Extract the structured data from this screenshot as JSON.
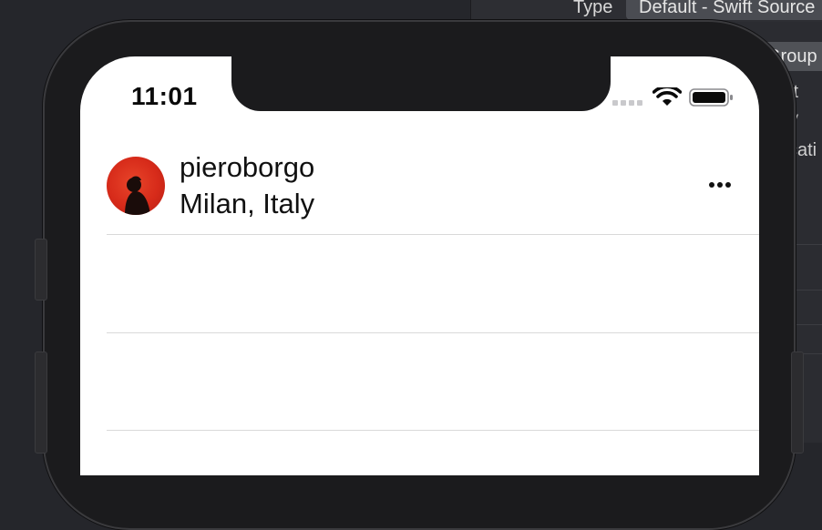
{
  "inspector": {
    "type_label": "Type",
    "type_value": "Default - Swift Source",
    "group_button": "Group",
    "fragments": [
      "ft",
      "y",
      "cati",
      "t"
    ]
  },
  "status_bar": {
    "time": "11:01",
    "icons": [
      "cellular-signal-icon",
      "wifi-icon",
      "battery-icon"
    ]
  },
  "post": {
    "username": "pieroborgo",
    "location": "Milan, Italy",
    "avatar_color": "#d72b1a",
    "more_icon": "ellipsis-icon"
  }
}
